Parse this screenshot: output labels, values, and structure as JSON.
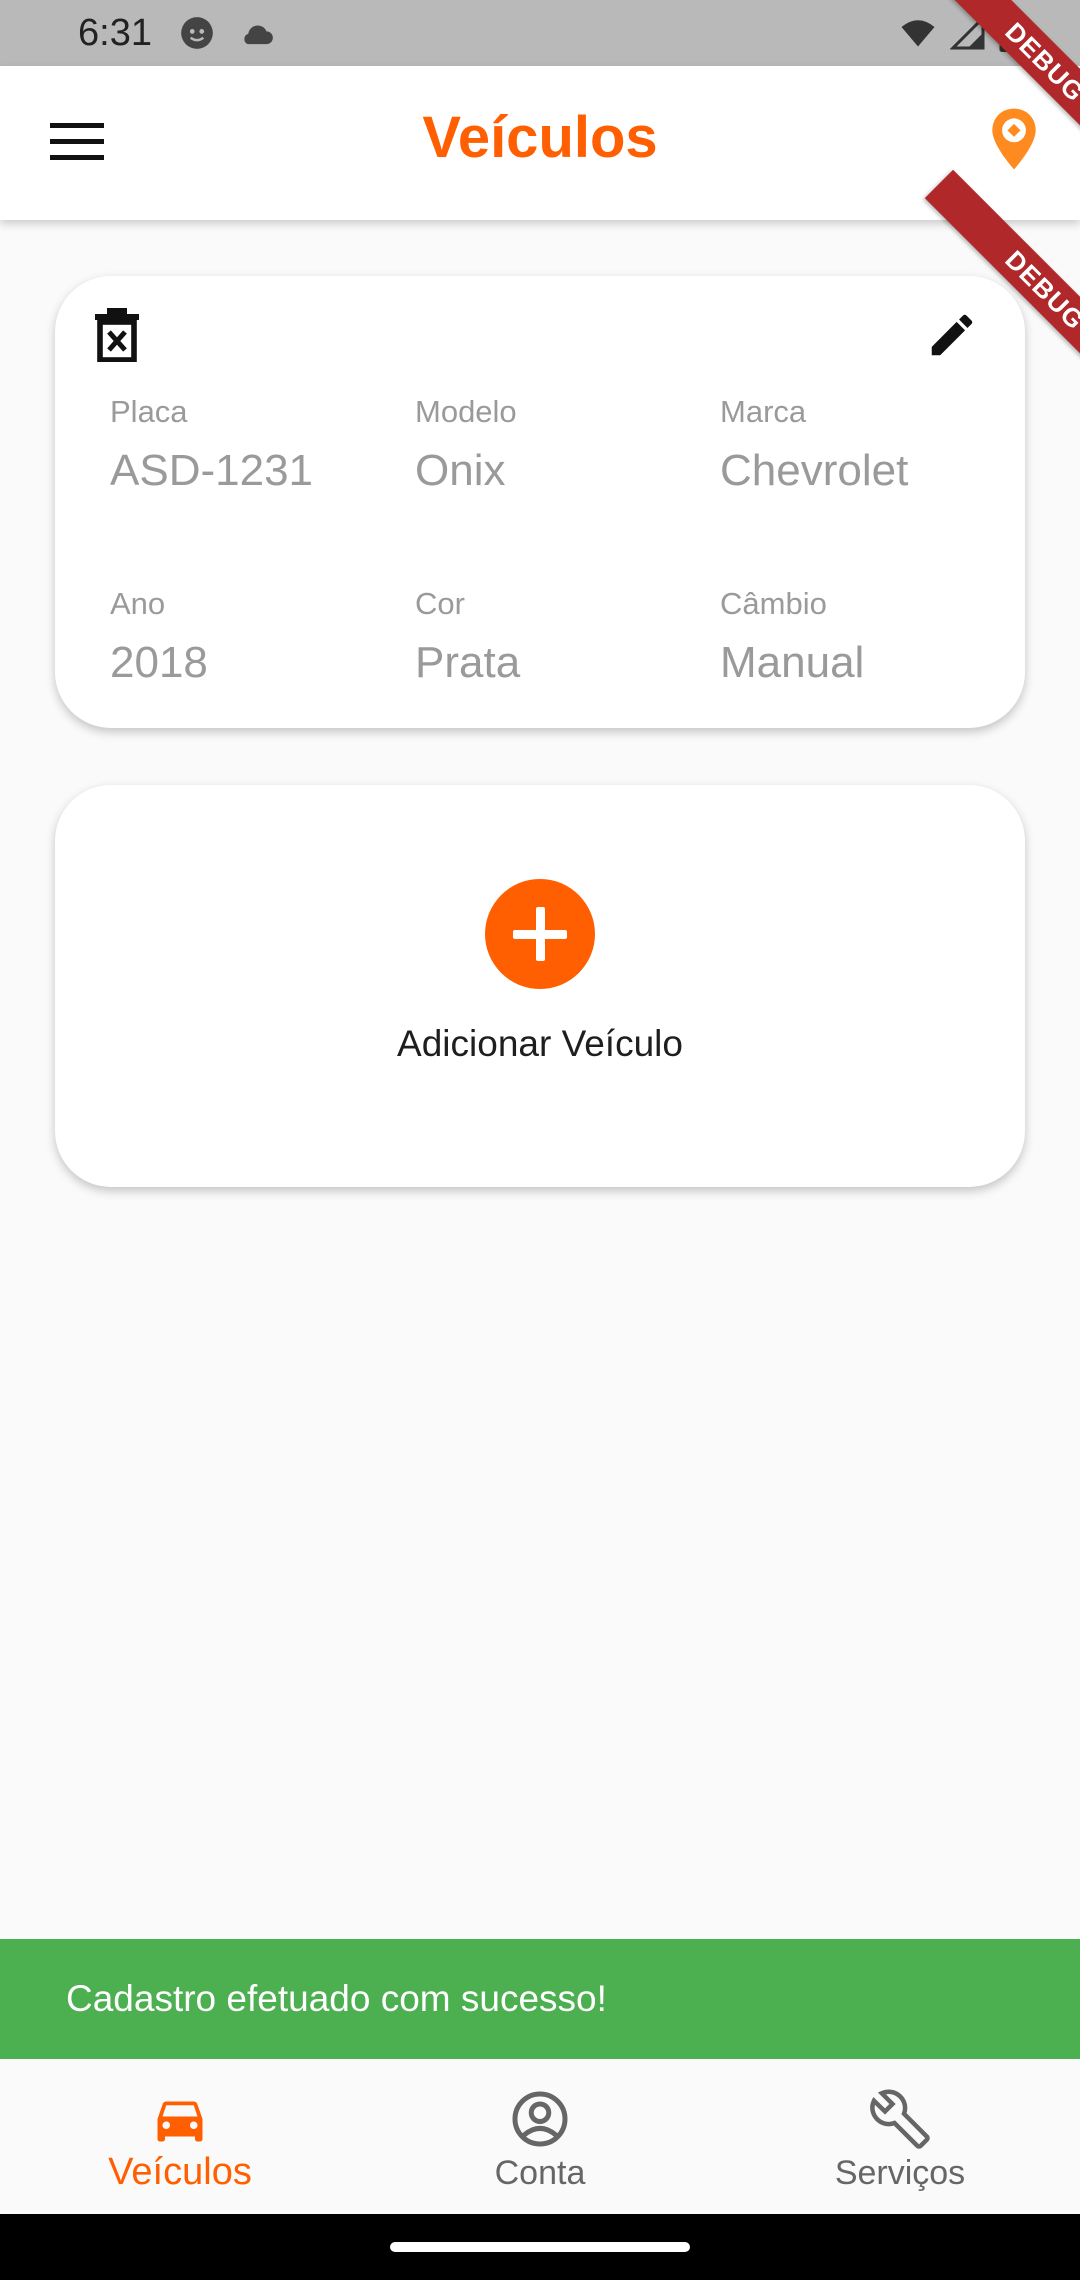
{
  "status_bar": {
    "time": "6:31",
    "icons": [
      "face-icon",
      "cloud-icon",
      "wifi-icon",
      "signal-icon",
      "battery-icon"
    ]
  },
  "app_bar": {
    "title": "Veículos",
    "menu_icon": "hamburger-menu-icon",
    "right_icon": "map-pin-icon"
  },
  "debug_banner": {
    "label": "DEBUG"
  },
  "vehicle": {
    "fields": [
      {
        "label": "Placa",
        "value": "ASD-1231"
      },
      {
        "label": "Modelo",
        "value": "Onix"
      },
      {
        "label": "Marca",
        "value": "Chevrolet"
      },
      {
        "label": "Ano",
        "value": "2018"
      },
      {
        "label": "Cor",
        "value": "Prata"
      },
      {
        "label": "Câmbio",
        "value": "Manual"
      }
    ]
  },
  "add_card": {
    "label": "Adicionar Veículo"
  },
  "snackbar": {
    "message": "Cadastro efetuado com sucesso!"
  },
  "bottom_nav": {
    "items": [
      {
        "label": "Veículos",
        "icon": "car-icon",
        "active": true
      },
      {
        "label": "Conta",
        "icon": "account-circle-icon",
        "active": false
      },
      {
        "label": "Serviços",
        "icon": "wrench-icon",
        "active": false
      }
    ]
  },
  "colors": {
    "accent": "#ff5f00",
    "success": "#4caf50",
    "debug": "#b0282a"
  }
}
